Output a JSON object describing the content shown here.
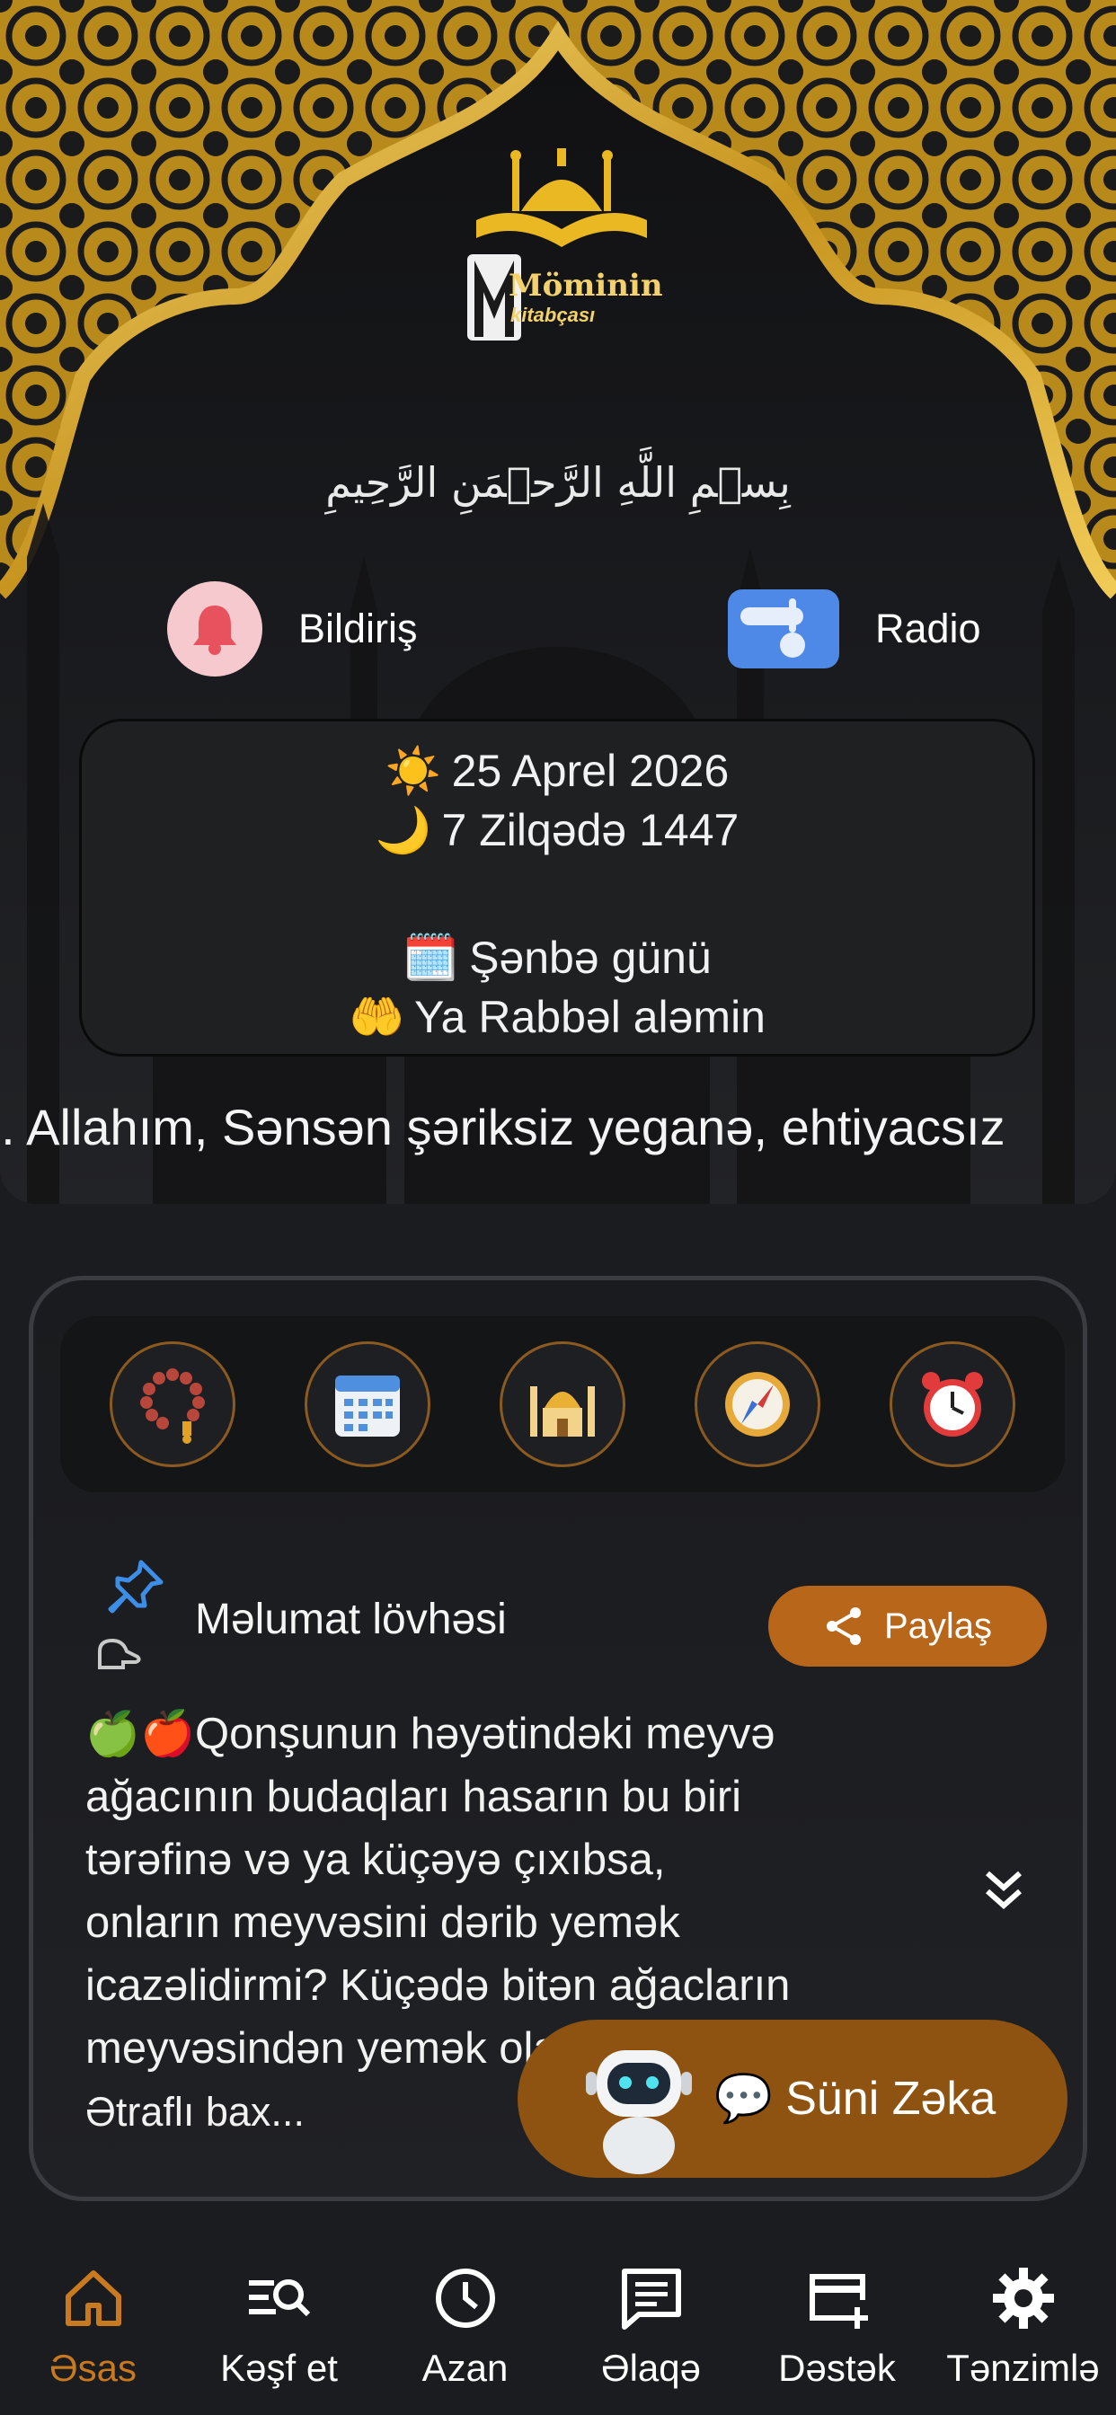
{
  "header": {
    "logo_title": "Möminin",
    "logo_subtitle": "kitabçası",
    "basmala": "بِسۡمِ اللَّهِ الرَّحۡمَنِ الرَّحِيمِ"
  },
  "quick_actions": [
    {
      "label": "Bildiriş",
      "icon": "bell-icon"
    },
    {
      "label": "Radio",
      "icon": "radio-icon"
    }
  ],
  "date_card": {
    "gregorian": "25 Aprel 2026",
    "hijri": "7 Zilqədə 1447",
    "weekday": "Şənbə günü",
    "dua": "Ya Rabbəl aləmin",
    "emojis": {
      "sun": "☀️",
      "moon": "🌙",
      "calendar": "🗓️",
      "hands": "🤲"
    }
  },
  "marquee_text": "n. Allahım, Sənsən şəriksiz yeganə, ehtiyacsız",
  "tools": [
    {
      "name": "tasbih",
      "icon": "prayer-beads-icon"
    },
    {
      "name": "calendar",
      "icon": "calendar-icon"
    },
    {
      "name": "mosque",
      "icon": "mosque-icon"
    },
    {
      "name": "qibla",
      "icon": "compass-icon"
    },
    {
      "name": "alarm",
      "icon": "alarm-clock-icon"
    }
  ],
  "board": {
    "title": "Məlumat lövhəsi",
    "share_label": "Paylaş",
    "article_lines": [
      "🍏🍎Qonşunun həyətindəki meyvə",
      "ağacının budaqları hasarın bu biri",
      "tərəfinə və ya küçəyə çıxıbsa,",
      "onların meyvəsini dərib yemək",
      "icazəlidirmi? Küçədə bitən ağacların",
      "meyvəsindən yemək olarmı?"
    ],
    "more_label": "Ətraflı bax..."
  },
  "ai_button": {
    "label": "💬 Süni Zəka"
  },
  "nav": {
    "items": [
      {
        "label": "Əsas",
        "icon": "home-icon",
        "active": true
      },
      {
        "label": "Kəşf et",
        "icon": "search-list-icon",
        "active": false
      },
      {
        "label": "Azan",
        "icon": "clock-icon",
        "active": false
      },
      {
        "label": "Əlaqə",
        "icon": "chat-icon",
        "active": false
      },
      {
        "label": "Dəstək",
        "icon": "card-plus-icon",
        "active": false
      },
      {
        "label": "Tənzimlə",
        "icon": "gear-icon",
        "active": false
      }
    ]
  },
  "colors": {
    "accent": "#c9791e",
    "gold": "#d4a52c",
    "background": "#1b1c1f",
    "share_button": "#b8671a",
    "ai_button": "#8e5311",
    "bell_bg": "#f6c9cf",
    "radio_bg": "#4f89e8"
  }
}
